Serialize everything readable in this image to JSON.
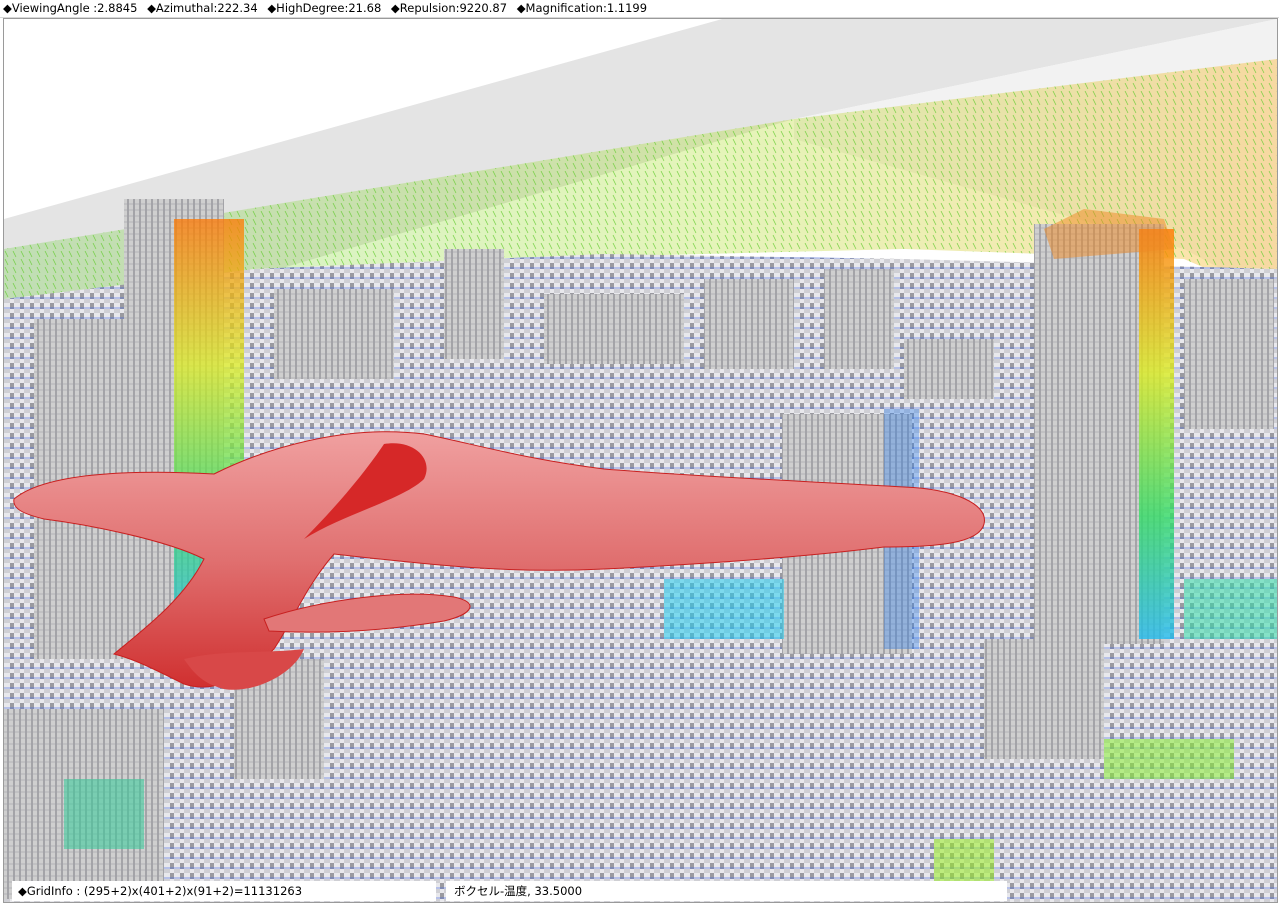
{
  "header": {
    "params": [
      {
        "label": "◆ViewingAngle :2.8845"
      },
      {
        "label": "◆Azimuthal:222.34"
      },
      {
        "label": "◆HighDegree:21.68"
      },
      {
        "label": "◆Repulsion:9220.87"
      },
      {
        "label": "◆Magnification:1.1199"
      }
    ]
  },
  "footer": {
    "grid_info": "◆GridInfo : (295+2)x(401+2)x(91+2)=11131263",
    "voxel_info": "ボクセル-温度, 33.5000"
  },
  "colors": {
    "background": "#ffffff",
    "building": "#c8c8c8",
    "building_shadow": "#8a8a8a",
    "vector_low": "#2255ff",
    "vector_mid": "#66dd22",
    "vector_high": "#ff8800",
    "isosurface": "#e03a3a"
  }
}
